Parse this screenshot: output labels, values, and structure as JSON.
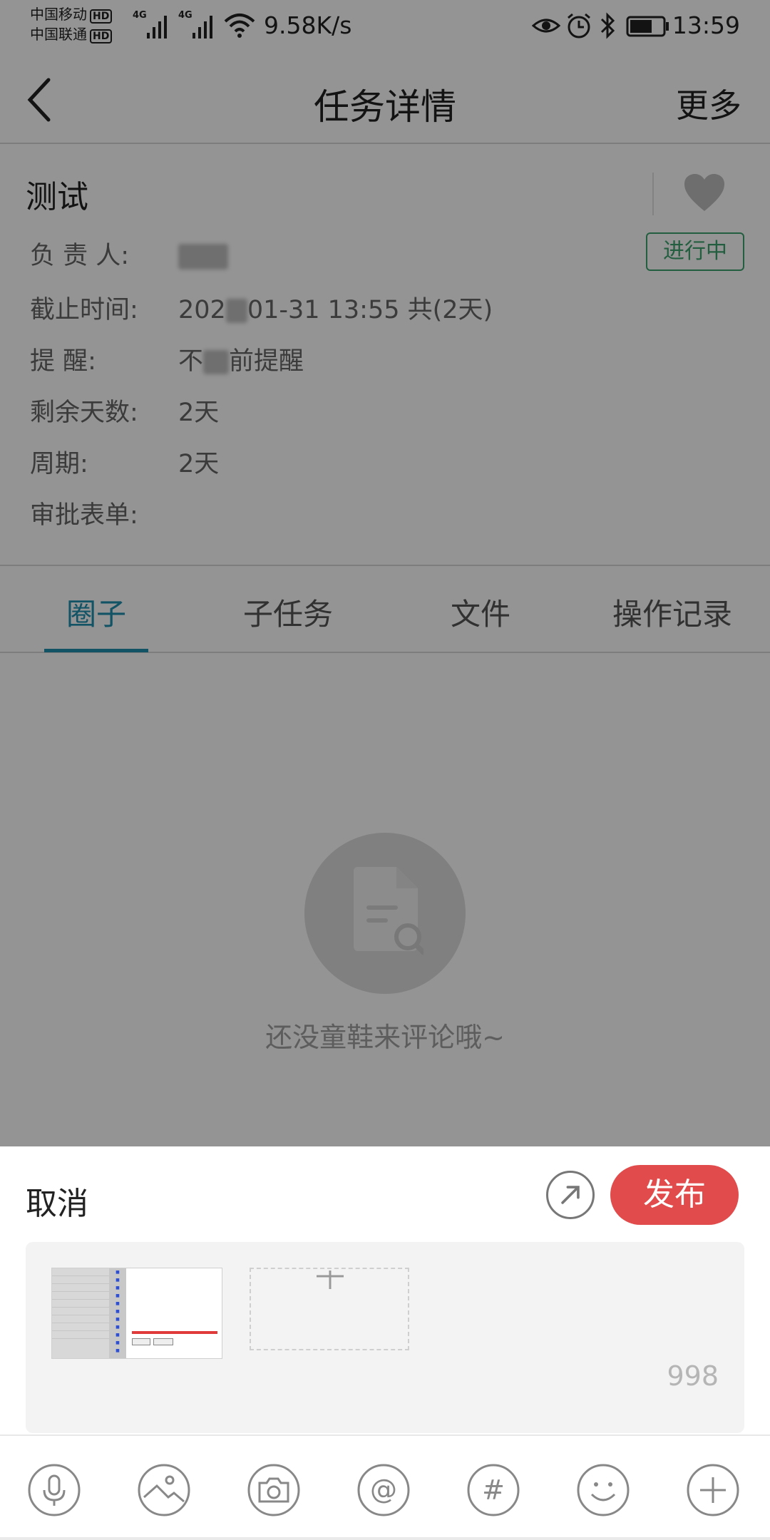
{
  "status_bar": {
    "carrier_1": "中国移动",
    "carrier_2": "中国联通",
    "hd_badge": "HD",
    "network_1": "4G",
    "network_2": "4G",
    "net_speed": "9.58K/s",
    "time": "13:59",
    "icons": [
      "eye-icon",
      "alarm-icon",
      "bluetooth-icon",
      "battery-icon",
      "wifi-icon",
      "signal-icon"
    ]
  },
  "header": {
    "title": "任务详情",
    "more_label": "更多"
  },
  "task": {
    "name": "测试",
    "status": "进行中",
    "fields": [
      {
        "label": "负 责 人:",
        "value": ""
      },
      {
        "label": "截止时间:",
        "value_prefix": "202",
        "value_suffix": "01-31 13:55 共(2天)"
      },
      {
        "label": "提      醒:",
        "value_prefix": "不",
        "value_suffix": "前提醒"
      },
      {
        "label": "剩余天数:",
        "value": "2天"
      },
      {
        "label": "周期:",
        "value": "2天"
      },
      {
        "label": "审批表单:",
        "value": ""
      }
    ]
  },
  "tabs": [
    {
      "label": "圈子",
      "active": true
    },
    {
      "label": "子任务",
      "active": false
    },
    {
      "label": "文件",
      "active": false
    },
    {
      "label": "操作记录",
      "active": false
    }
  ],
  "empty_state": {
    "text": "还没童鞋来评论哦~"
  },
  "comment_sheet": {
    "cancel_label": "取消",
    "publish_label": "发布",
    "char_counter": "998"
  },
  "colors": {
    "accent_tab": "#1f8fb0",
    "status_green": "#3fa36e",
    "publish_red": "#e14b4b"
  }
}
